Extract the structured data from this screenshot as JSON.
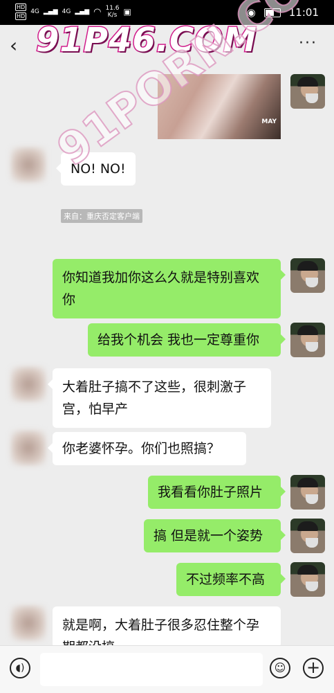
{
  "status_bar": {
    "hd1": "HD",
    "hd2": "HD",
    "signal1": "4G",
    "signal2": "4G",
    "net_speed": "11.6",
    "net_unit": "K/s",
    "time": "11:01"
  },
  "nav": {
    "back_icon": "chevron-left",
    "more_icon": "more-dots",
    "more_label": "···"
  },
  "watermark": {
    "top": "91P46.COM",
    "diagonal": "91PORN.COM",
    "photo_brand": "MAY"
  },
  "source_note": "来自：重庆否定客户端",
  "messages": [
    {
      "dir": "out",
      "type": "image"
    },
    {
      "dir": "in",
      "text": "NO! NO!"
    },
    {
      "dir": "out",
      "text": "你知道我加你这么久就是特别喜欢你"
    },
    {
      "dir": "out",
      "text": "给我个机会 我也一定尊重你"
    },
    {
      "dir": "in",
      "text": "大着肚子搞不了这些，很刺激子宫，怕早产"
    },
    {
      "dir": "in",
      "text": "你老婆怀孕。你们也照搞？"
    },
    {
      "dir": "out",
      "text": "我看看你肚子照片"
    },
    {
      "dir": "out",
      "text": "搞 但是就一个姿势"
    },
    {
      "dir": "out",
      "text": "不过频率不高"
    },
    {
      "dir": "in",
      "text": "就是啊，大着肚子很多忍住整个孕期都没搞"
    }
  ],
  "input_bar": {
    "voice_icon": "voice-icon",
    "placeholder": "",
    "emoji_icon": "emoji-icon",
    "plus_icon": "plus-icon"
  }
}
